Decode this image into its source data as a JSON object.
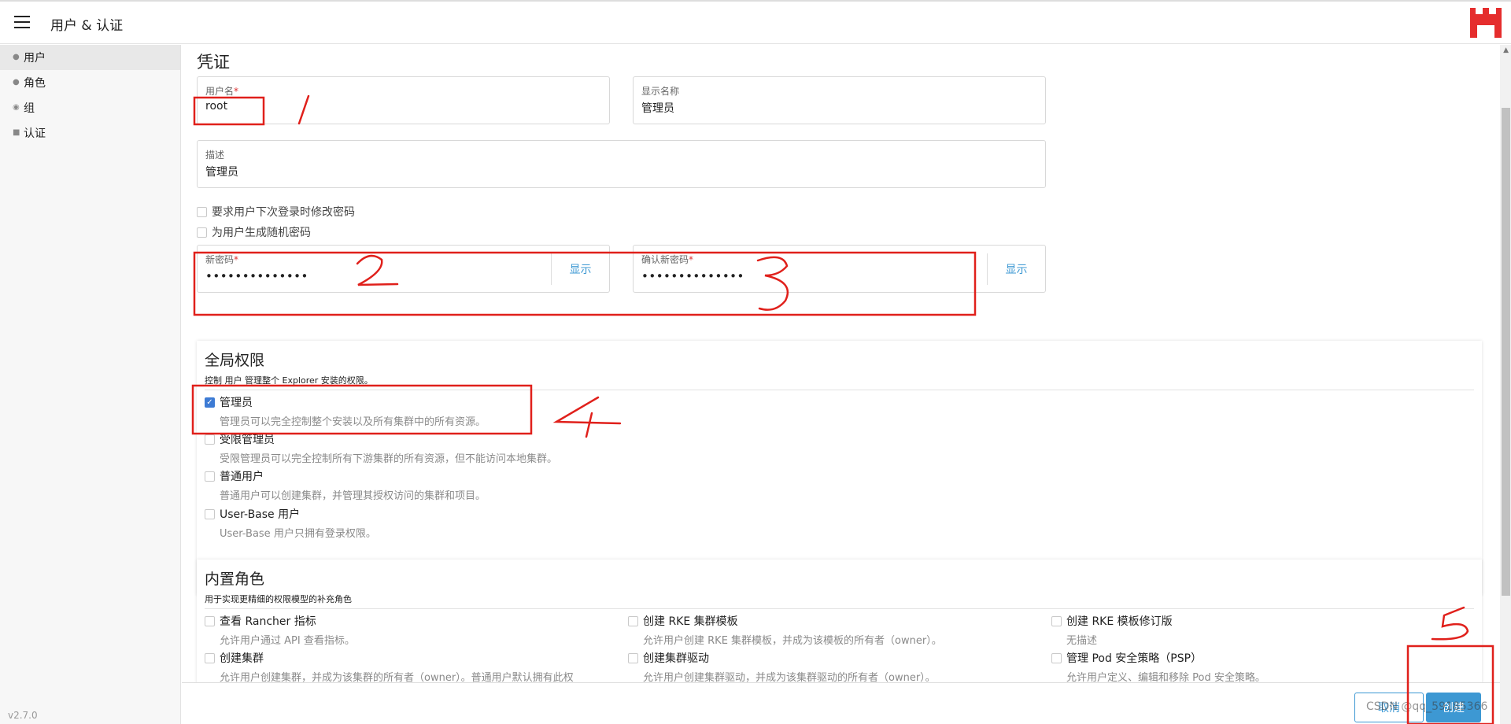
{
  "header": {
    "title": "用户 & 认证",
    "menu_icon": "hamburger-icon",
    "logo_icon": "rancher-logo-icon",
    "logo_color": "#e52d2d"
  },
  "sidebar": {
    "items": [
      {
        "label": "用户",
        "icon": "user-icon",
        "glyph": "👤"
      },
      {
        "label": "角色",
        "icon": "role-icon",
        "glyph": "👤"
      },
      {
        "label": "组",
        "icon": "group-icon",
        "glyph": "●"
      },
      {
        "label": "认证",
        "icon": "lock-icon",
        "glyph": "🔒"
      }
    ],
    "version": "v2.7.0"
  },
  "credentials": {
    "title": "凭证",
    "username_label": "用户名",
    "username_value": "root",
    "display_name_label": "显示名称",
    "display_name_value": "管理员",
    "description_label": "描述",
    "description_value": "管理员",
    "require_change_label": "要求用户下次登录时修改密码",
    "random_password_label": "为用户生成随机密码",
    "new_password_label": "新密码",
    "new_password_value": "••••••••••••••",
    "confirm_password_label": "确认新密码",
    "confirm_password_value": "••••••••••••••",
    "show_label": "显示",
    "required_mark": "*"
  },
  "global_permissions": {
    "title": "全局权限",
    "subtitle": "控制 用户 管理整个 Explorer 安装的权限。",
    "options": [
      {
        "label": "管理员",
        "desc": "管理员可以完全控制整个安装以及所有集群中的所有资源。",
        "checked": true
      },
      {
        "label": "受限管理员",
        "desc": "受限管理员可以完全控制所有下游集群的所有资源，但不能访问本地集群。",
        "checked": false
      },
      {
        "label": "普通用户",
        "desc": "普通用户可以创建集群，并管理其授权访问的集群和项目。",
        "checked": false
      },
      {
        "label": "User-Base 用户",
        "desc": "User-Base 用户只拥有登录权限。",
        "checked": false
      }
    ]
  },
  "builtin_roles": {
    "title": "内置角色",
    "subtitle": "用于实现更精细的权限模型的补充角色",
    "options": [
      {
        "label": "查看 Rancher 指标",
        "desc": "允许用户通过 API 查看指标。"
      },
      {
        "label": "创建 RKE 集群模板",
        "desc": "允许用户创建 RKE 集群模板，并成为该模板的所有者（owner）。"
      },
      {
        "label": "创建 RKE 模板修订版",
        "desc": "无描述"
      },
      {
        "label": "创建集群",
        "desc": "允许用户创建集群，并成为该集群的所有者（owner）。普通用户默认拥有此权"
      },
      {
        "label": "创建集群驱动",
        "desc": "允许用户创建集群驱动，并成为该集群驱动的所有者（owner）。"
      },
      {
        "label": "管理 Pod 安全策略（PSP）",
        "desc": "允许用户定义、编辑和移除 Pod 安全策略。"
      }
    ]
  },
  "footer": {
    "cancel_label": "取消",
    "create_label": "创建",
    "watermark": "CSDN @qq_59185366"
  },
  "annotations": {
    "marks": [
      "1",
      "2",
      "3",
      "4",
      "5"
    ],
    "color": "#e0201b"
  }
}
